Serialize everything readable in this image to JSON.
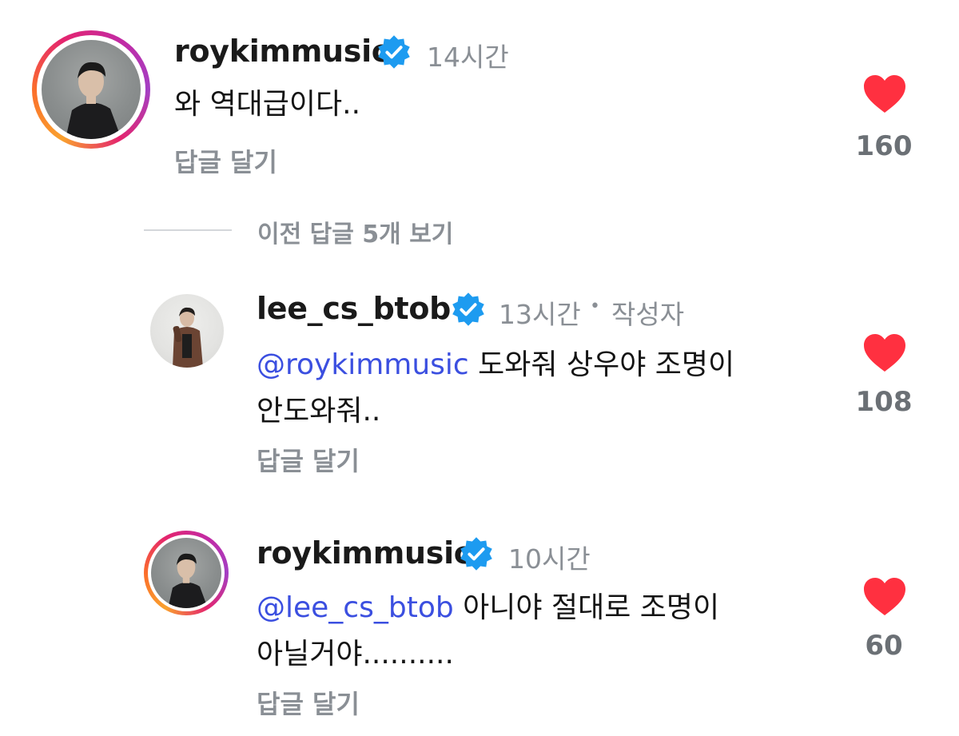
{
  "comments": [
    {
      "username": "roykimmusic",
      "time": "14시간",
      "text": "와 역대급이다..",
      "reply_label": "답글 달기",
      "likes": "160"
    },
    {
      "username": "lee_cs_btob",
      "time": "13시간",
      "meta_sep": "•",
      "author_tag": "작성자",
      "mention": "@roykimmusic",
      "text_line1": " 도와줘 상우야 조명이",
      "text_line2": "안도와줘..",
      "reply_label": "답글 달기",
      "likes": "108"
    },
    {
      "username": "roykimmusic",
      "time": "10시간",
      "mention": "@lee_cs_btob",
      "text_line1": " 아니야 절대로 조명이",
      "text_line2": "아닐거야..........",
      "reply_label": "답글 달기",
      "likes": "60"
    }
  ],
  "view_previous_replies": "이전 답글 5개 보기",
  "colors": {
    "heart": "#ff3040",
    "verified": "#1d9bf0",
    "mention": "#3b4fe0",
    "secondary_text": "#8a8f95"
  },
  "icons": {
    "verified": "verified-badge-icon",
    "like": "heart-icon",
    "mention_prefix": "threads-at-icon"
  }
}
